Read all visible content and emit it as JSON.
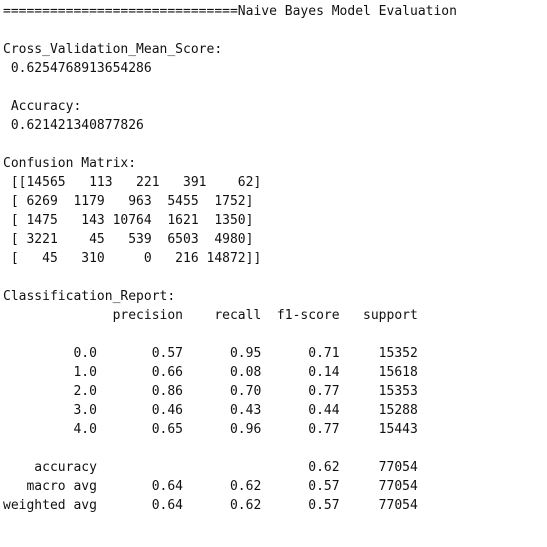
{
  "title_line": "==============================Naive Bayes Model Evaluation",
  "cv": {
    "label": "Cross_Validation_Mean_Score:",
    "value": " 0.6254768913654286"
  },
  "accuracy": {
    "label": " Accuracy:",
    "value": " 0.621421340877826"
  },
  "confusion_matrix": {
    "label": "Confusion Matrix:",
    "rows": [
      " [[14565   113   221   391    62]",
      " [ 6269  1179   963  5455  1752]",
      " [ 1475   143 10764  1621  1350]",
      " [ 3221    45   539  6503  4980]",
      " [   45   310     0   216 14872]]"
    ]
  },
  "classification_report": {
    "label": "Classification_Report:",
    "header": "              precision    recall  f1-score   support",
    "class_rows": [
      "         0.0       0.57      0.95      0.71     15352",
      "         1.0       0.66      0.08      0.14     15618",
      "         2.0       0.86      0.70      0.77     15353",
      "         3.0       0.46      0.43      0.44     15288",
      "         4.0       0.65      0.96      0.77     15443"
    ],
    "summary_rows": [
      "    accuracy                           0.62     77054",
      "   macro avg       0.64      0.62      0.57     77054",
      "weighted avg       0.64      0.62      0.57     77054"
    ]
  }
}
